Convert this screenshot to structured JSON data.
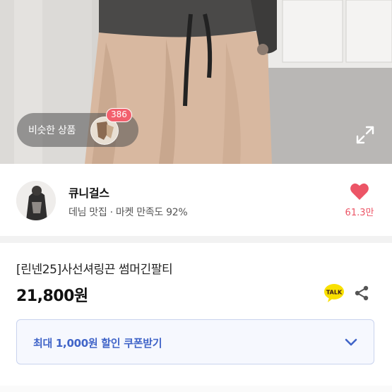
{
  "hero": {
    "similar_label": "비슷한 상품",
    "similar_count": "386",
    "icons": {
      "expand": "expand-icon",
      "similar_thumb": "product-thumbnail"
    }
  },
  "shop": {
    "name": "큐니걸스",
    "meta": "데님 맛집 · 마켓 만족도 92%",
    "like_count": "61.3만",
    "icons": {
      "like": "heart-icon",
      "avatar": "shop-avatar"
    }
  },
  "product": {
    "name": "[린넨25]사선셔링끈 썸머긴팔티",
    "price": "21,800원",
    "talk_badge": "TALK",
    "icons": {
      "talk": "kakao-talk-icon",
      "share": "share-icon"
    }
  },
  "coupon": {
    "label": "최대 1,000원 할인 쿠폰받기",
    "icons": {
      "chevron": "chevron-down-icon"
    }
  },
  "colors": {
    "accent_blue": "#4064c8",
    "heart_red": "#ec5566",
    "badge_red": "#f2606d",
    "talk_yellow": "#f9e000"
  }
}
